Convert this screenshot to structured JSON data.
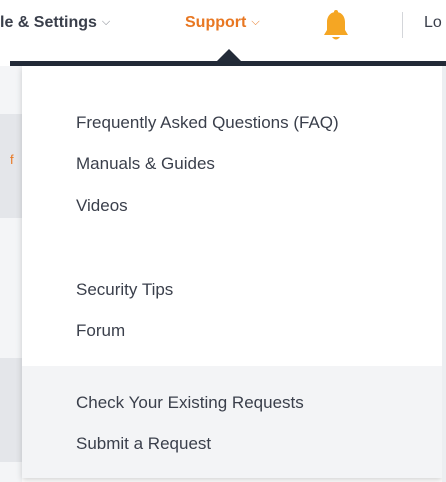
{
  "nav": {
    "settings_label": "le & Settings",
    "support_label": "Support",
    "login_fragment": "Lo",
    "chevron": "⌄",
    "bell_icon": "bell-icon",
    "support_color": "#e87722",
    "bell_color": "#f5a623"
  },
  "background_fragment": "f",
  "dropdown": {
    "group1": [
      {
        "label": "Frequently Asked Questions (FAQ)"
      },
      {
        "label": "Manuals & Guides"
      },
      {
        "label": "Videos"
      }
    ],
    "group2": [
      {
        "label": "Security Tips"
      },
      {
        "label": "Forum"
      }
    ],
    "footer": [
      {
        "label": "Check Your Existing Requests"
      },
      {
        "label": "Submit a Request"
      }
    ]
  }
}
